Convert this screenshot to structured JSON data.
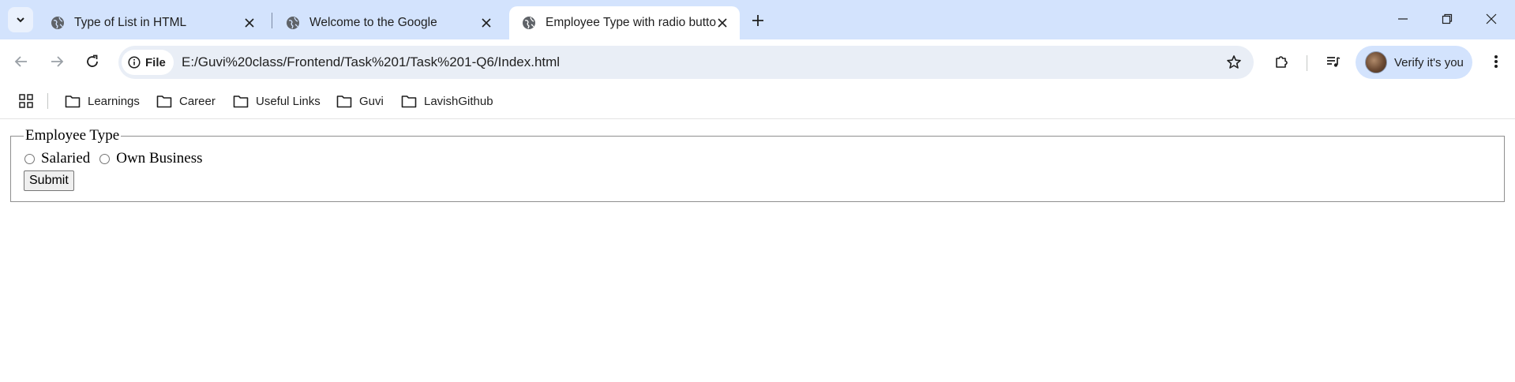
{
  "tabs": [
    {
      "title": "Type of List in HTML",
      "active": false
    },
    {
      "title": "Welcome to the Google",
      "active": false
    },
    {
      "title": "Employee Type with radio butto",
      "active": true
    }
  ],
  "toolbar": {
    "site_chip_label": "File",
    "url": "E:/Guvi%20class/Frontend/Task%201/Task%201-Q6/Index.html",
    "profile_label": "Verify it's you"
  },
  "bookmarks": [
    {
      "label": "Learnings"
    },
    {
      "label": "Career"
    },
    {
      "label": "Useful Links"
    },
    {
      "label": "Guvi"
    },
    {
      "label": "LavishGithub"
    }
  ],
  "form": {
    "legend": "Employee Type",
    "options": [
      {
        "label": "Salaried",
        "checked": false
      },
      {
        "label": "Own Business",
        "checked": false
      }
    ],
    "submit_label": "Submit"
  },
  "colors": {
    "tab_strip": "#d3e3fd",
    "omnibox": "#e9eef6",
    "profile_chip": "#d3e3fd"
  }
}
